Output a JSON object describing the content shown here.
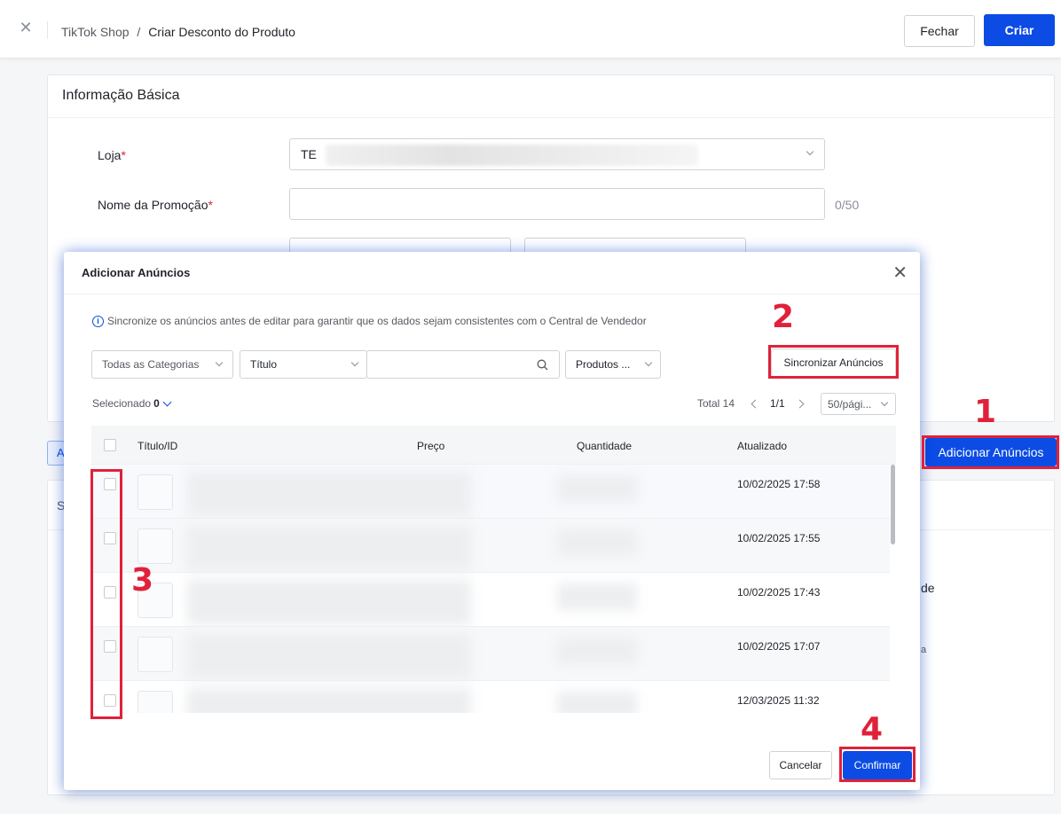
{
  "header": {
    "breadcrumb_root": "TikTok Shop",
    "breadcrumb_sep": "/",
    "breadcrumb_current": "Criar Desconto do Produto",
    "close_label": "Fechar",
    "create_label": "Criar"
  },
  "basic_info": {
    "title": "Informação Básica",
    "store_label": "Loja",
    "store_value": "TE",
    "promo_name_label": "Nome da Promoção",
    "promo_name_value": "",
    "promo_name_counter": "0/50",
    "required_mark": "*"
  },
  "page_actions": {
    "add_listings_label": "Adicionar Anúncios",
    "mini_button_text": "A",
    "behind_text_s": "S",
    "behind_text_de": "de",
    "behind_text_a": "a"
  },
  "modal": {
    "title": "Adicionar Anúncios",
    "notice": "Sincronize os anúncios antes de editar para garantir que os dados sejam consistentes com o Central de Vendedor",
    "filters": {
      "category": "Todas as Categorias",
      "search_field": "Título",
      "search_value": "",
      "product_status": "Produtos ..."
    },
    "sync_label": "Sincronizar Anúncios",
    "selected_label": "Selecionado",
    "selected_count": "0",
    "total_label": "Total 14",
    "page_indicator": "1/1",
    "page_size": "50/pági...",
    "columns": [
      "Título/ID",
      "Preço",
      "Quantidade",
      "Atualizado"
    ],
    "rows": [
      {
        "updated": "10/02/2025 17:58"
      },
      {
        "updated": "10/02/2025 17:55"
      },
      {
        "updated": "10/02/2025 17:43"
      },
      {
        "updated": "10/02/2025 17:07"
      },
      {
        "updated": "12/03/2025 11:32"
      }
    ],
    "cancel_label": "Cancelar",
    "confirm_label": "Confirmar"
  },
  "annotations": [
    "1",
    "2",
    "3",
    "4"
  ],
  "colors": {
    "primary": "#0c4ce5",
    "annotation": "#e0213a",
    "required": "#e0213a"
  }
}
